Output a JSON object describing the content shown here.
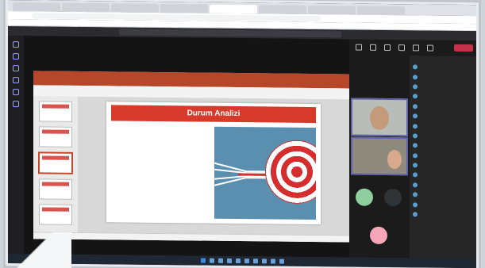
{
  "browser": {
    "tabs": [
      "",
      "",
      "",
      "",
      "",
      "",
      "",
      ""
    ],
    "address": ""
  },
  "teams": {
    "meeting_title": "",
    "leave_label": "",
    "participants_header": "",
    "participants": [
      "",
      "",
      "",
      "",
      "",
      "",
      "",
      "",
      "",
      "",
      "",
      "",
      "",
      "",
      "",
      ""
    ]
  },
  "ppt": {
    "slide_title": "Durum Analizi",
    "bullets": [
      "",
      "",
      "",
      "",
      "",
      "",
      "",
      "",
      "",
      "",
      ""
    ],
    "bullet_colors": [
      "#444444",
      "#444444",
      "#e8a300",
      "#2e9e3e",
      "#2e9e3e",
      "#2b7bd1",
      "#7a3ab8",
      "#d62e2e",
      "#d62e2e"
    ],
    "status": ""
  },
  "colors": {
    "accent": "#6264a7",
    "ppt_brand": "#b7472a",
    "slide_title_bg": "#d73a2a",
    "leave": "#c4314b"
  },
  "taskbar": {
    "clock": ""
  }
}
